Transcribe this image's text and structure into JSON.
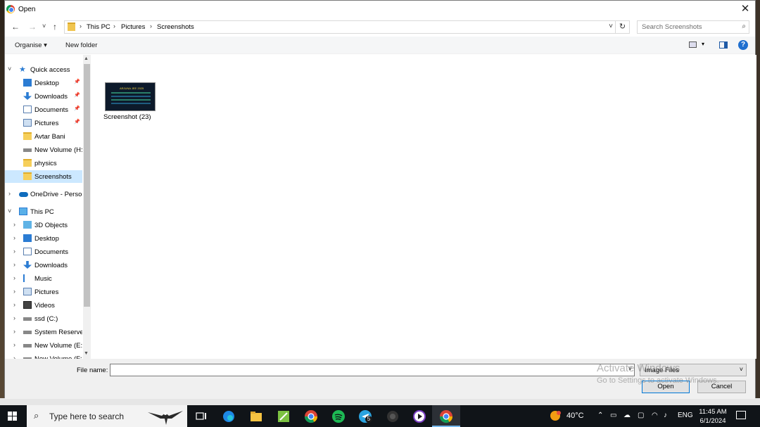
{
  "dialog": {
    "title": "Open",
    "close_glyph": "✕"
  },
  "nav": {
    "back": "←",
    "forward": "→",
    "recent": "˅",
    "up": "↑",
    "breadcrumb": [
      "This PC",
      "Pictures",
      "Screenshots"
    ],
    "refresh": "↻",
    "search_placeholder": "Search Screenshots"
  },
  "toolbar": {
    "organise": "Organise ▾",
    "new_folder": "New folder",
    "help": "?"
  },
  "sidebar": {
    "quick_access": "Quick access",
    "quick_items": [
      {
        "label": "Desktop",
        "icon": "desktop-icon",
        "pinned": true
      },
      {
        "label": "Downloads",
        "icon": "downloads-icon",
        "pinned": true
      },
      {
        "label": "Documents",
        "icon": "documents-icon",
        "pinned": true
      },
      {
        "label": "Pictures",
        "icon": "pictures-icon",
        "pinned": true
      },
      {
        "label": "Avtar Bani",
        "icon": "folder-icon",
        "pinned": false
      },
      {
        "label": "New Volume (H:",
        "icon": "drive-icon",
        "pinned": false
      },
      {
        "label": "physics",
        "icon": "folder-icon",
        "pinned": false
      },
      {
        "label": "Screenshots",
        "icon": "folder-icon",
        "pinned": false,
        "selected": true
      }
    ],
    "onedrive": "OneDrive - Persor",
    "this_pc": "This PC",
    "pc_items": [
      {
        "label": "3D Objects",
        "icon": "3d-objects-icon"
      },
      {
        "label": "Desktop",
        "icon": "desktop-icon"
      },
      {
        "label": "Documents",
        "icon": "documents-icon"
      },
      {
        "label": "Downloads",
        "icon": "downloads-icon"
      },
      {
        "label": "Music",
        "icon": "music-icon"
      },
      {
        "label": "Pictures",
        "icon": "pictures-icon"
      },
      {
        "label": "Videos",
        "icon": "videos-icon"
      },
      {
        "label": "ssd (C:)",
        "icon": "drive-icon"
      },
      {
        "label": "System Reservec",
        "icon": "drive-icon"
      },
      {
        "label": "New Volume (E:)",
        "icon": "drive-icon"
      },
      {
        "label": "New Volume (F:)",
        "icon": "drive-icon"
      }
    ]
  },
  "files": [
    {
      "name": "Screenshot (23)",
      "thumb_title": "ARJUNA JEE 2025"
    }
  ],
  "footer": {
    "file_name_label": "File name:",
    "file_name_value": "",
    "file_type": "Image Files",
    "open": "Open",
    "cancel": "Cancel"
  },
  "watermark": {
    "line1": "Activate Windows",
    "line2": "Go to Settings to activate Windows."
  },
  "taskbar": {
    "search_placeholder": "Type here to search",
    "temperature": "40°C",
    "language": "ENG",
    "time": "11:45 AM",
    "date": "6/1/2024",
    "telegram_badge": "5"
  }
}
